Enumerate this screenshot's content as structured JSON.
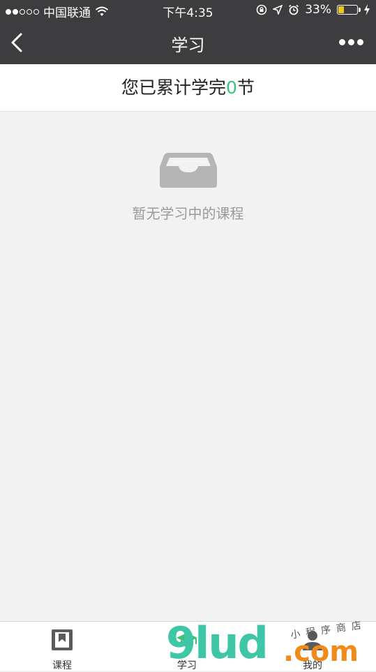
{
  "status_bar": {
    "carrier": "中国联通",
    "time": "下午4:35",
    "battery_percent": "33%",
    "battery_level": 0.33,
    "signal_bars_filled": 2,
    "signal_bars_total": 5
  },
  "nav": {
    "title": "学习",
    "back_icon": "chevron-left-icon",
    "more_icon": "more-dots-icon"
  },
  "summary": {
    "prefix": "您已累计学完",
    "count": "0",
    "suffix": "节",
    "accent_color": "#3cc17a"
  },
  "empty_state": {
    "icon": "empty-tray-icon",
    "text": "暂无学习中的课程"
  },
  "tabbar": {
    "tabs": [
      {
        "label": "课程",
        "icon": "course-book-icon"
      },
      {
        "label": "学习",
        "icon": "study-cap-icon"
      },
      {
        "label": "我的",
        "icon": "profile-icon"
      }
    ]
  },
  "watermark": {
    "main": "9lud",
    "domain": ".com",
    "handwriting": "小程序商店"
  }
}
